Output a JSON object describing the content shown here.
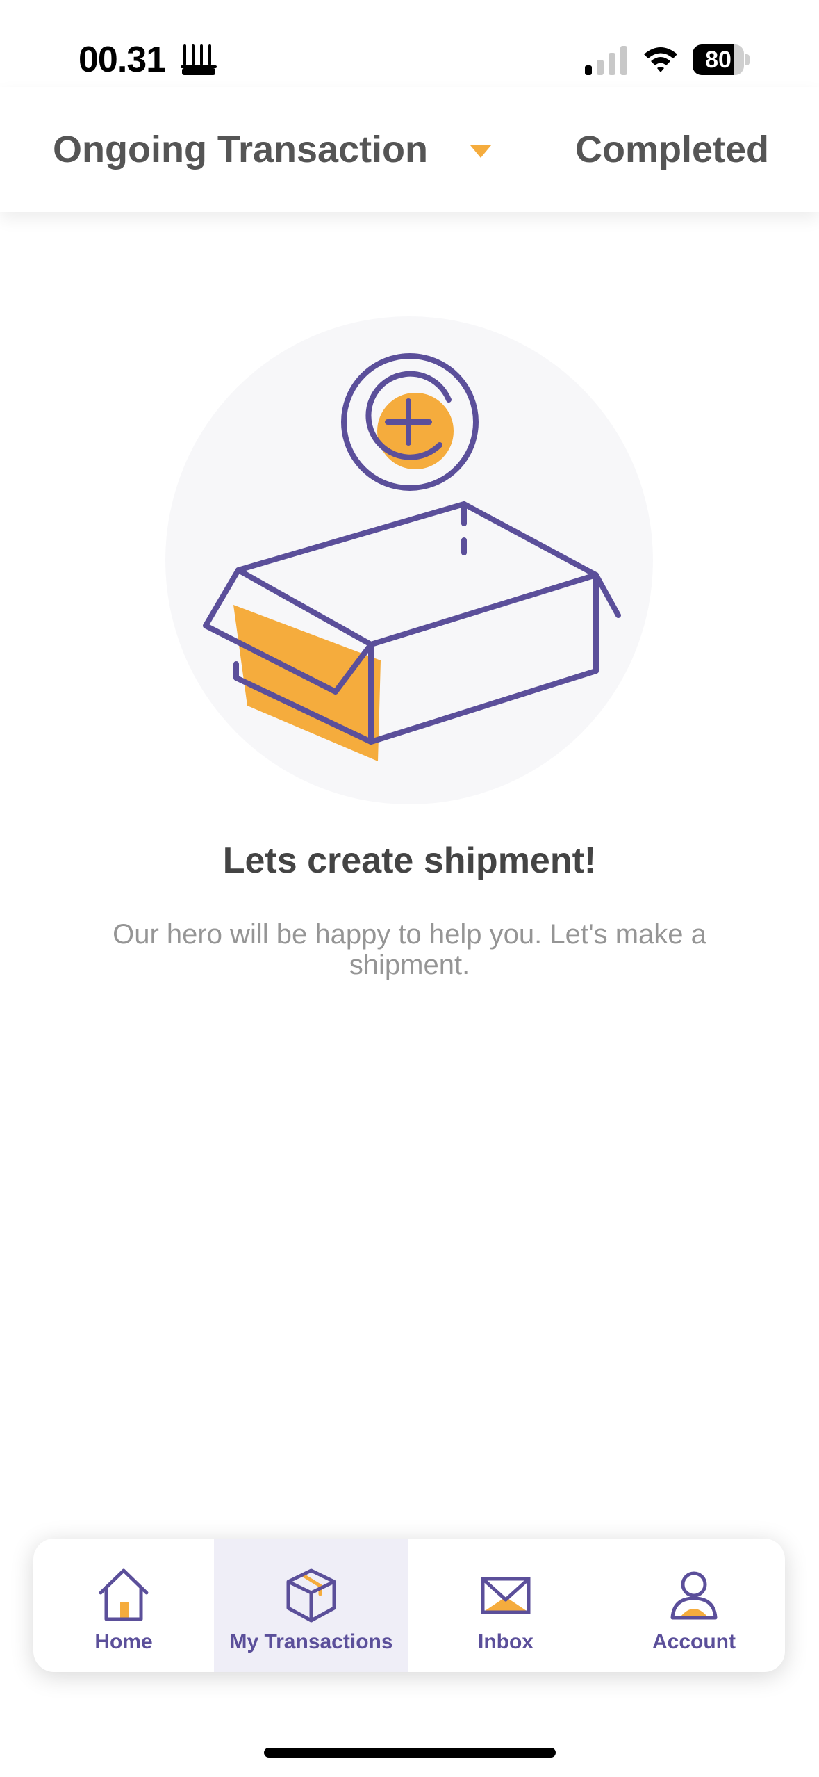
{
  "status_bar": {
    "time": "00.31",
    "battery": "80",
    "battery_level": 0.8
  },
  "tabs": {
    "ongoing": "Ongoing Transaction",
    "completed": "Completed",
    "active": "ongoing"
  },
  "empty_state": {
    "title": "Lets create shipment!",
    "description": "Our hero will be happy to help you. Let's make a shipment."
  },
  "bottom_nav": {
    "items": [
      {
        "label": "Home",
        "icon": "home-icon"
      },
      {
        "label": "My Transactions",
        "icon": "box-icon",
        "active": true
      },
      {
        "label": "Inbox",
        "icon": "mail-icon"
      },
      {
        "label": "Account",
        "icon": "person-icon"
      }
    ]
  },
  "colors": {
    "brand": "#5b4f9a",
    "accent": "#f5ac3d",
    "text": "#444444",
    "muted": "#959595"
  }
}
